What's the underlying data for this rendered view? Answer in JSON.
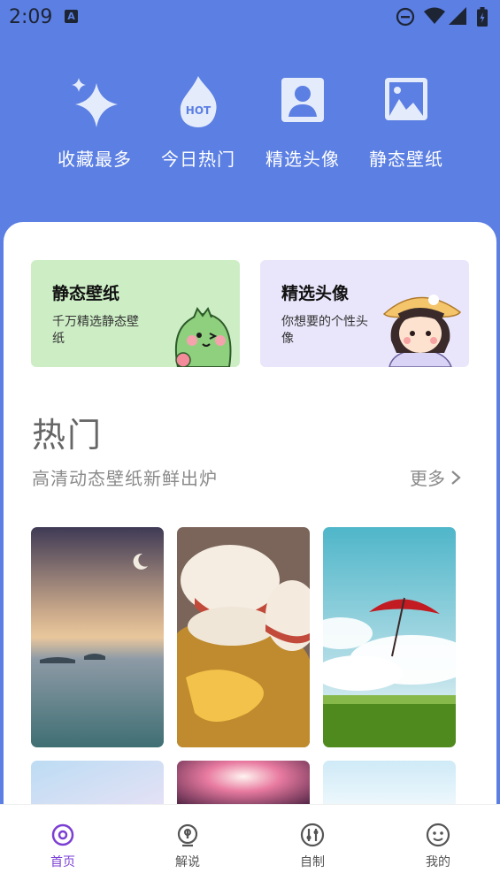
{
  "status_bar": {
    "time": "2:09",
    "notification_badge": "A",
    "icons": [
      "do-not-disturb-icon",
      "wifi-icon",
      "cell-signal-icon",
      "battery-icon"
    ]
  },
  "categories": [
    {
      "label": "收藏最多",
      "icon": "sparkle-icon"
    },
    {
      "label": "今日热门",
      "icon": "hot-flame-icon",
      "icon_text": "HOT"
    },
    {
      "label": "精选头像",
      "icon": "portrait-icon"
    },
    {
      "label": "静态壁纸",
      "icon": "image-icon"
    }
  ],
  "promos": [
    {
      "title": "静态壁纸",
      "desc": "千万精选静态壁纸",
      "color": "#cdeec5"
    },
    {
      "title": "精选头像",
      "desc": "你想要的个性头像",
      "color": "#e9e6fb"
    }
  ],
  "hot_section": {
    "title": "热门",
    "subtitle": "高清动态壁纸新鲜出炉",
    "more_label": "更多"
  },
  "wallpapers": [
    {
      "name": "sunset-sea-moon"
    },
    {
      "name": "macarons"
    },
    {
      "name": "red-umbrella-sky"
    },
    {
      "name": "pastel-blue"
    },
    {
      "name": "pink-glow"
    },
    {
      "name": "light-sky"
    }
  ],
  "bottom_nav": [
    {
      "label": "首页",
      "icon": "home-target-icon",
      "active": true
    },
    {
      "label": "解说",
      "icon": "location-pin-icon",
      "active": false
    },
    {
      "label": "自制",
      "icon": "sliders-icon",
      "active": false
    },
    {
      "label": "我的",
      "icon": "smiley-icon",
      "active": false
    }
  ],
  "colors": {
    "header_bg": "#5b7fe3",
    "accent": "#7b3fd4"
  }
}
